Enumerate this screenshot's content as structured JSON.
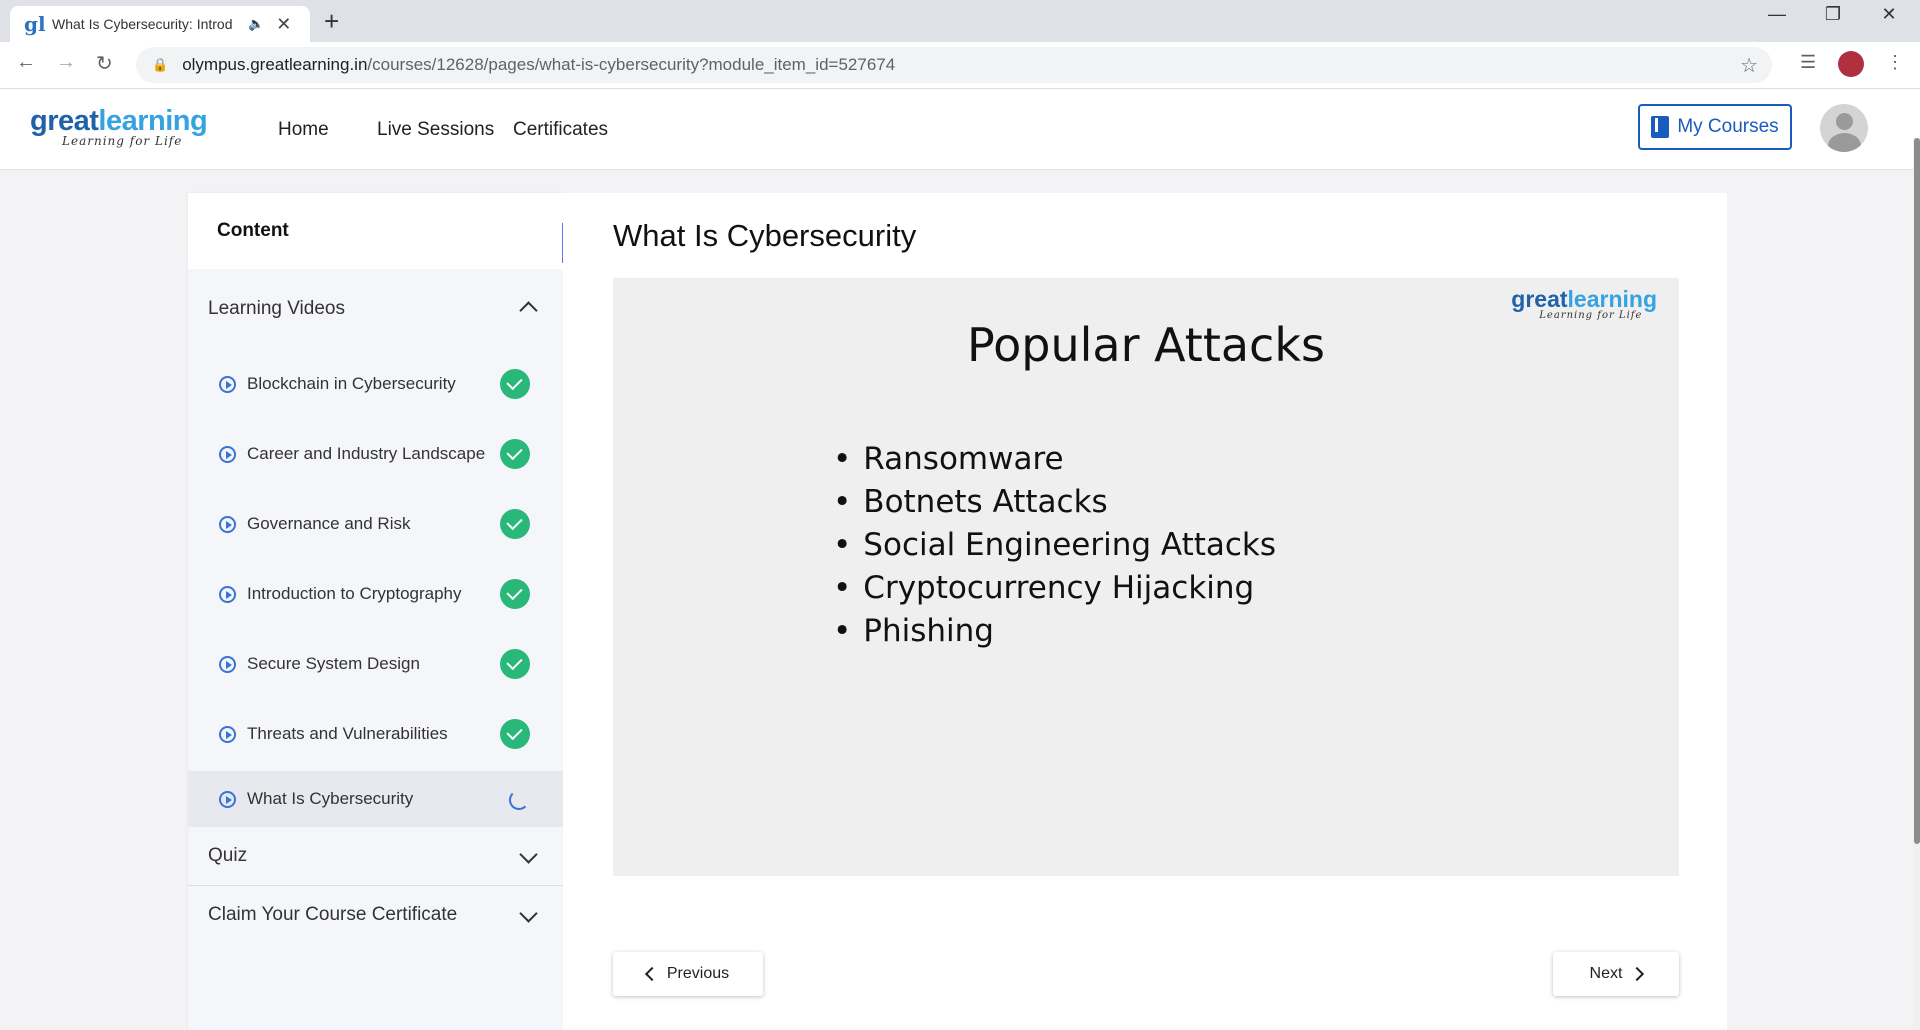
{
  "browser": {
    "tab_title": "What Is Cybersecurity: Introd",
    "tab_favicon": "gl",
    "url_domain": "olympus.greatlearning.in",
    "url_path": "/courses/12628/pages/what-is-cybersecurity?module_item_id=527674",
    "icons": {
      "audio": "speaker-icon",
      "close": "close-icon",
      "new_tab": "plus-icon",
      "back": "back-arrow-icon",
      "forward": "forward-arrow-icon",
      "reload": "reload-icon",
      "lock": "lock-icon",
      "star": "star-icon",
      "media": "media-queue-icon",
      "menu": "kebab-menu-icon"
    }
  },
  "header": {
    "logo_part1": "great",
    "logo_part2": "learning",
    "logo_tagline": "Learning for Life",
    "nav": [
      "Home",
      "Live Sessions",
      "Certificates"
    ],
    "my_courses_label": "My Courses"
  },
  "sidebar": {
    "title": "Content",
    "sections": [
      {
        "title": "Learning Videos",
        "expanded": true,
        "items": [
          {
            "label": "Blockchain in Cybersecurity",
            "status": "completed"
          },
          {
            "label": "Career and Industry Landscape",
            "status": "completed"
          },
          {
            "label": "Governance and Risk",
            "status": "completed"
          },
          {
            "label": "Introduction to Cryptography",
            "status": "completed"
          },
          {
            "label": "Secure System Design",
            "status": "completed"
          },
          {
            "label": "Threats and Vulnerabilities",
            "status": "completed"
          },
          {
            "label": "What Is Cybersecurity",
            "status": "in-progress"
          }
        ]
      },
      {
        "title": "Quiz",
        "expanded": false
      },
      {
        "title": "Claim Your Course Certificate",
        "expanded": false
      }
    ]
  },
  "main": {
    "page_title": "What Is Cybersecurity",
    "slide": {
      "logo_part1": "great",
      "logo_part2": "learning",
      "logo_tagline": "Learning for Life",
      "title": "Popular Attacks",
      "bullets": [
        "Ransomware",
        "Botnets Attacks",
        "Social Engineering Attacks",
        "Cryptocurrency Hijacking",
        "Phishing"
      ]
    },
    "previous_label": "Previous",
    "next_label": "Next"
  },
  "colors": {
    "accent": "#1a5bbf",
    "completed": "#29b879",
    "collapse_button": "#5b7be8"
  }
}
